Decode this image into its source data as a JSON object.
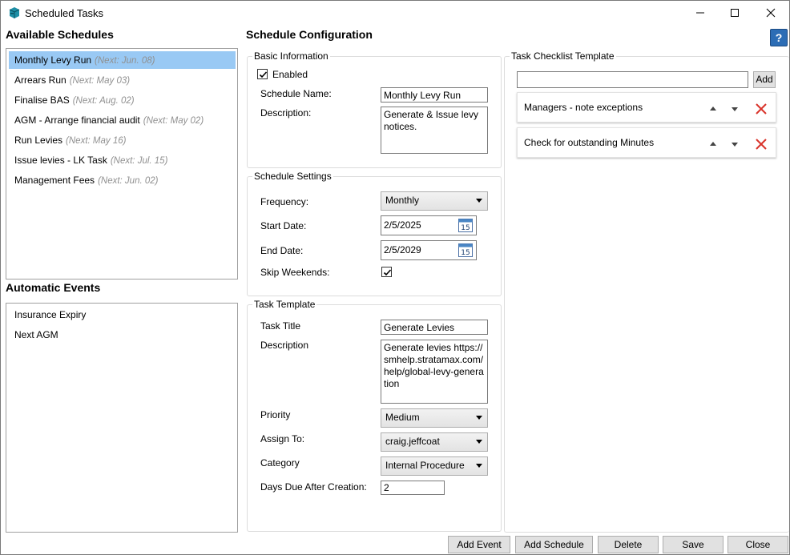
{
  "window": {
    "title": "Scheduled Tasks"
  },
  "available_schedules": {
    "heading": "Available Schedules",
    "items": [
      {
        "name": "Monthly Levy Run",
        "next": "(Next: Jun. 08)",
        "selected": true
      },
      {
        "name": "Arrears Run",
        "next": "(Next: May 03)"
      },
      {
        "name": "Finalise BAS",
        "next": "(Next: Aug. 02)"
      },
      {
        "name": "AGM - Arrange financial audit",
        "next": "(Next: May 02)"
      },
      {
        "name": "Run Levies",
        "next": "(Next: May 16)"
      },
      {
        "name": "Issue levies - LK Task",
        "next": "(Next: Jul. 15)"
      },
      {
        "name": "Management Fees",
        "next": "(Next: Jun. 02)"
      }
    ]
  },
  "automatic_events": {
    "heading": "Automatic Events",
    "items": [
      "Insurance Expiry",
      "Next AGM"
    ]
  },
  "config": {
    "heading": "Schedule Configuration",
    "basic": {
      "title": "Basic Information",
      "enabled_label": "Enabled",
      "enabled": true,
      "name_label": "Schedule Name:",
      "name_value": "Monthly Levy Run",
      "desc_label": "Description:",
      "desc_value": "Generate & Issue levy notices."
    },
    "settings": {
      "title": "Schedule Settings",
      "frequency_label": "Frequency:",
      "frequency_value": "Monthly",
      "start_label": "Start Date:",
      "start_value": "2/5/2025",
      "end_label": "End Date:",
      "end_value": "2/5/2029",
      "calendar_day": "15",
      "skip_label": "Skip Weekends:",
      "skip_weekends": true
    },
    "task": {
      "title": "Task Template",
      "task_title_label": "Task Title",
      "task_title_value": "Generate Levies",
      "desc_label": "Description",
      "desc_value": "Generate levies https://smhelp.stratamax.com/help/global-levy-generation",
      "priority_label": "Priority",
      "priority_value": "Medium",
      "assign_label": "Assign To:",
      "assign_value": "craig.jeffcoat",
      "category_label": "Category",
      "category_value": "Internal Procedure",
      "days_label": "Days Due After Creation:",
      "days_value": "2"
    }
  },
  "checklist": {
    "title": "Task Checklist Template",
    "input_value": "",
    "add_label": "Add",
    "items": [
      "Managers - note exceptions",
      "Check for outstanding Minutes"
    ]
  },
  "footer": {
    "add_event": "Add Event",
    "add_schedule": "Add Schedule",
    "delete": "Delete",
    "save": "Save",
    "close": "Close"
  },
  "help_label": "?",
  "colors": {
    "selection": "#99c9f4",
    "delete_red": "#d9342b",
    "help_blue": "#2c6db5"
  }
}
